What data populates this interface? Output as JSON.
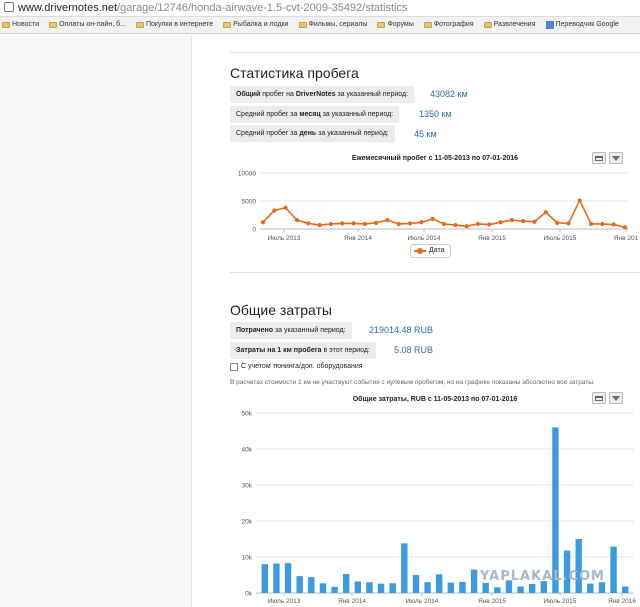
{
  "browser": {
    "url_host": "www.drivernotes.net",
    "url_path": "/garage/12746/honda-airwave-1.5-cvt-2009-35492/statistics",
    "bookmarks": [
      "Новости",
      "Оплаты он-лайн, б...",
      "Покупки в интернете",
      "Рыбалка и лодки",
      "Фильмы, сериалы",
      "Форумы",
      "Фотография",
      "Развлечения",
      "Переводчик Google"
    ]
  },
  "mileage": {
    "title": "Статистика пробега",
    "rows": [
      {
        "bold": "Общий",
        "text": " пробег на ",
        "bold2": "DriverNotes",
        "text2": " за указанный период:",
        "value": "43082 км"
      },
      {
        "bold": "",
        "text": "Средний пробег за ",
        "bold2": "месяц",
        "text2": " за указанный период:",
        "value": "1350 км"
      },
      {
        "bold": "",
        "text": "Средний пробег за ",
        "bold2": "день",
        "text2": " за указанный период:",
        "value": "45 км"
      }
    ],
    "legend": "Дата"
  },
  "costs": {
    "title": "Общие затраты",
    "rows": [
      {
        "bold": "Потрачено",
        "text": " за указанный период:",
        "value": "219014.48 RUB"
      },
      {
        "bold": "Затраты на 1 км пробега",
        "text": " в этот период:",
        "value": "5.08 RUB"
      }
    ],
    "checkbox_label": "С учетом тюнинга/доп. оборудования",
    "note": "В расчетах стоимости 1 км не участвуют события с нулевым пробегом, но на графике показаны абсолютно все затраты."
  },
  "watermark": "YAPLAKAL.COM",
  "chart_data": [
    {
      "type": "line",
      "title": "Ежемесячный пробег с 11-05-2013 по 07-01-2016",
      "ylim": [
        0,
        10000
      ],
      "yticks": [
        "10000",
        "5000",
        "0"
      ],
      "xticks": [
        "Июль 2013",
        "Янв 2014",
        "Июль 2014",
        "Янв 2015",
        "Июль 2015",
        "Янв 201"
      ],
      "color": "#e66a1a",
      "series": [
        {
          "name": "Дата",
          "values": [
            1200,
            3300,
            3800,
            1600,
            1000,
            700,
            900,
            1000,
            1000,
            900,
            1100,
            1600,
            900,
            1000,
            1200,
            1800,
            900,
            700,
            500,
            900,
            800,
            1200,
            1600,
            1400,
            1300,
            3000,
            1100,
            1000,
            5100,
            900,
            900,
            800,
            300
          ]
        }
      ]
    },
    {
      "type": "bar",
      "title": "Общие затраты, RUB с 11-05-2013 по 07-01-2016",
      "ylim": [
        0,
        50000
      ],
      "yticks": [
        "50k",
        "40k",
        "30k",
        "20k",
        "10k",
        "0k"
      ],
      "xticks": [
        "Июль 2013",
        "Янв 2014",
        "Июль 2014",
        "Янв 2015",
        "Июль 2015",
        "Янв 2016"
      ],
      "color": "#3a9be0",
      "values": [
        8000,
        8200,
        8300,
        4700,
        4400,
        2700,
        1700,
        5300,
        3200,
        3000,
        2600,
        2700,
        13800,
        5000,
        3000,
        5200,
        2900,
        3100,
        6500,
        2800,
        1600,
        3500,
        1800,
        2500,
        3300,
        46000,
        11800,
        15000,
        2600,
        3000,
        12900,
        1800
      ]
    }
  ]
}
